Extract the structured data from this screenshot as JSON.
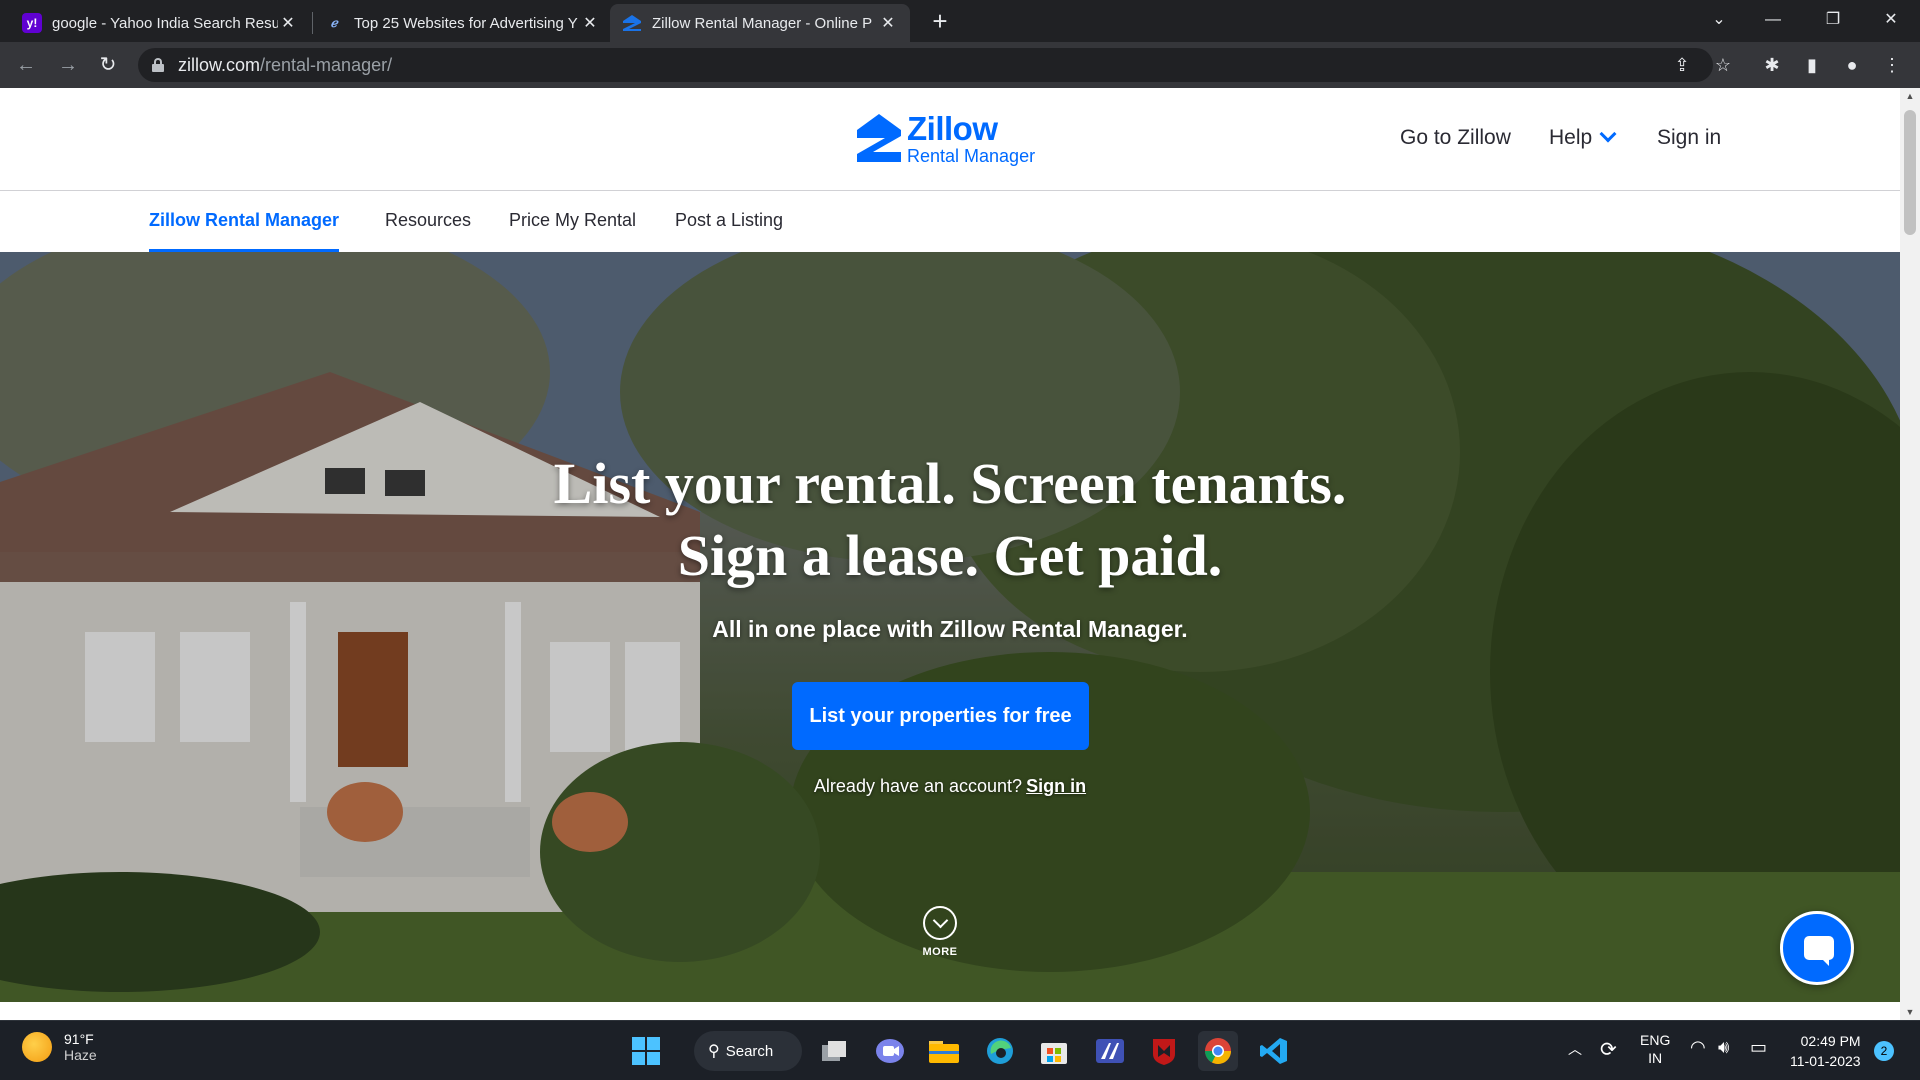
{
  "browser": {
    "tabs": [
      {
        "title": "google - Yahoo India Search Resu",
        "favicon": "yahoo-icon",
        "active": false
      },
      {
        "title": "Top 25 Websites for Advertising Y",
        "favicon": "site-icon",
        "active": false
      },
      {
        "title": "Zillow Rental Manager - Online P",
        "favicon": "zillow-icon",
        "active": true
      }
    ],
    "url_host": "zillow.com",
    "url_path": "/rental-manager/"
  },
  "header": {
    "logo_brand": "Zillow",
    "logo_sub": "Rental Manager",
    "go_to_zillow": "Go to Zillow",
    "help": "Help",
    "sign_in": "Sign in"
  },
  "subnav": {
    "items": [
      {
        "label": "Zillow Rental Manager",
        "active": true
      },
      {
        "label": "Resources",
        "active": false
      },
      {
        "label": "Price My Rental",
        "active": false
      },
      {
        "label": "Post a Listing",
        "active": false
      }
    ]
  },
  "hero": {
    "title_line1": "List your rental. Screen tenants.",
    "title_line2": "Sign a lease. Get paid.",
    "subtitle": "All in one place with Zillow Rental Manager.",
    "cta": "List your properties for free",
    "already_text": "Already have an account?",
    "already_link": "Sign in",
    "more_label": "MORE"
  },
  "taskbar": {
    "temperature": "91°F",
    "condition": "Haze",
    "search_label": "Search",
    "lang_top": "ENG",
    "lang_bottom": "IN",
    "time": "02:49 PM",
    "date": "11-01-2023",
    "notification_count": "2"
  },
  "colors": {
    "zillow_blue": "#006aff",
    "chrome_dark": "#202124",
    "chrome_toolbar": "#35363a"
  }
}
